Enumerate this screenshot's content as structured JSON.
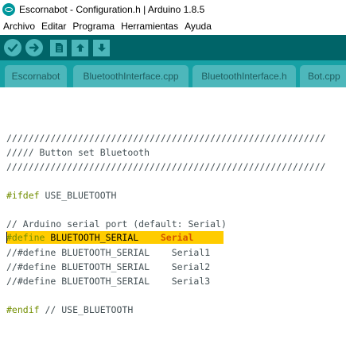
{
  "window": {
    "title": "Escornabot - Configuration.h | Arduino 1.8.5"
  },
  "menu": {
    "items": [
      "Archivo",
      "Editar",
      "Programa",
      "Herramientas",
      "Ayuda"
    ]
  },
  "toolbar": {
    "buttons": [
      "verify-icon",
      "upload-icon",
      "new-icon",
      "open-icon",
      "save-icon"
    ]
  },
  "tabs": {
    "items": [
      "Escornabot",
      "BluetoothInterface.cpp",
      "BluetoothInterface.h",
      "Bot.cpp"
    ]
  },
  "code": {
    "l1": "//////////////////////////////////////////////////////////",
    "l2": "///// Button set Bluetooth",
    "l3": "//////////////////////////////////////////////////////////",
    "l4_kw": "#ifdef",
    "l4_rest": " USE_BLUETOOTH",
    "l5": "// Arduino serial port (default: Serial)",
    "l6_kw": "#define",
    "l6_mid": " BLUETOOTH_SERIAL    ",
    "l6_val": "Serial",
    "l7": "//#define BLUETOOTH_SERIAL    Serial1",
    "l8": "//#define BLUETOOTH_SERIAL    Serial2",
    "l9": "//#define BLUETOOTH_SERIAL    Serial3",
    "l10_kw": "#endif",
    "l10_rest": " // USE_BLUETOOTH"
  },
  "colors": {
    "toolbar_bg": "#006468",
    "tabbar_bg": "#17a1a5",
    "button_bg": "#4db7bb",
    "highlight": "#ffcc00",
    "preprocessor": "#728e00",
    "constant": "#d35400"
  }
}
